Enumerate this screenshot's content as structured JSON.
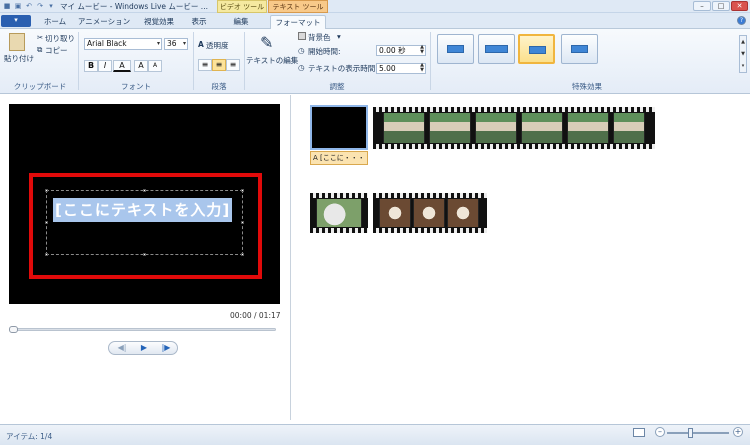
{
  "window": {
    "title": "マイ ムービー - Windows Live ムービー ...",
    "context_video": "ビデオ ツール",
    "context_text": "テキスト ツール",
    "controls": [
      "–",
      "□",
      "✕"
    ]
  },
  "tabs": {
    "file": "▾",
    "items": [
      "ホーム",
      "アニメーション",
      "視覚効果",
      "表示",
      "編集",
      "フォーマット"
    ],
    "active": "フォーマット"
  },
  "ribbon": {
    "clipboard": {
      "paste": "貼り付け",
      "cut": "切り取り",
      "copy": "コピー",
      "label": "クリップボード"
    },
    "font": {
      "family": "Arial Black",
      "size": "36",
      "bold": "B",
      "italic": "I",
      "color": "A",
      "grow": "A",
      "shrink": "A",
      "label": "フォント"
    },
    "paragraph": {
      "transparency": "透明度",
      "label": "段落"
    },
    "adjust": {
      "edit_text": "テキストの編集",
      "bg_color": "背景色",
      "start_time_label": "開始時間:",
      "start_time_value": "0.00 秒",
      "duration_label": "テキストの表示時間:",
      "duration_value": "5.00",
      "label": "調整"
    },
    "effects": {
      "label": "特殊効果",
      "selected_index": 2
    }
  },
  "preview": {
    "caption": "[ここにテキストを入力]",
    "time": "00:00 / 01:17",
    "progress": 0.0,
    "controls": {
      "prev": "◀|",
      "play": "▶",
      "next": "|▶"
    }
  },
  "storyboard": {
    "caption_chip": "A [ここに・・・"
  },
  "status": {
    "items": "アイテム: 1/4",
    "zoom_minus": "–",
    "zoom_plus": "+"
  },
  "colors": {
    "highlight_frame": "#e10a0a",
    "caption_bg": "#a9c6ec",
    "selected_effect": "#f0b53e"
  }
}
